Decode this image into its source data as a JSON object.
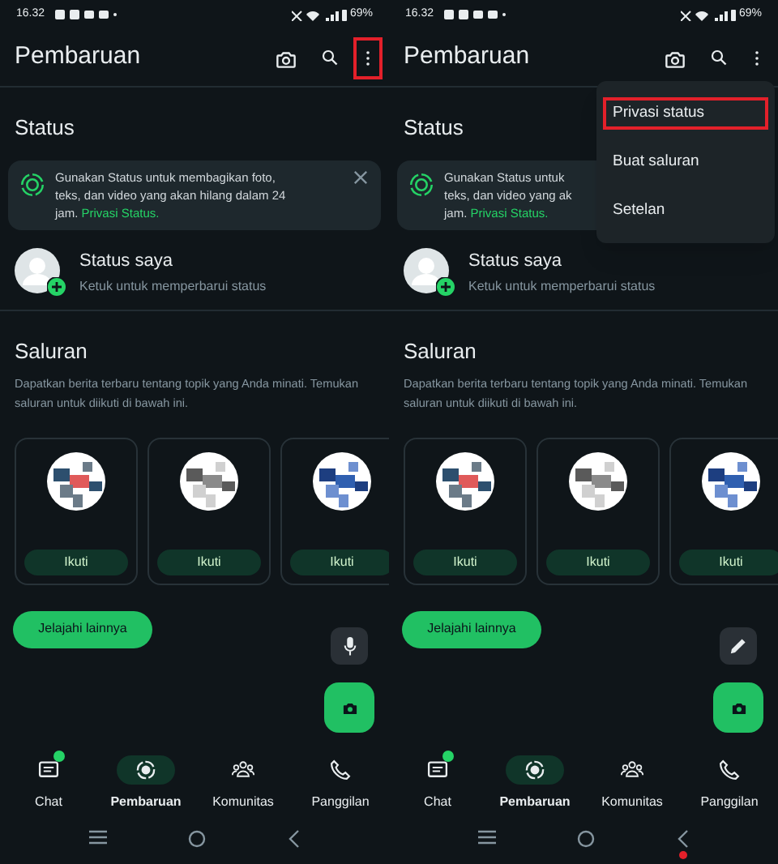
{
  "screens": [
    {
      "status_bar": {
        "time": "16.32",
        "battery": "69%"
      },
      "app_bar": {
        "title": "Pembaruan",
        "more_highlighted": true
      },
      "status": {
        "heading": "Status",
        "tip_lines": [
          "Gunakan Status untuk membagikan foto,",
          "teks, dan video yang akan hilang dalam 24",
          "jam."
        ],
        "tip_link": "Privasi Status.",
        "dismissible": true,
        "my_status": "Status saya",
        "my_status_hint": "Ketuk untuk memperbarui status"
      },
      "channels": {
        "heading": "Saluran",
        "description": "Dapatkan berita terbaru tentang topik yang Anda minati. Temukan saluran untuk diikuti di bawah ini.",
        "cards": [
          {
            "button": "Ikuti"
          },
          {
            "button": "Ikuti"
          },
          {
            "button": "Ikuti"
          }
        ],
        "explore_button": "Jelajahi lainnya"
      },
      "secondary_fab": {
        "kind": "mic"
      },
      "bottom_nav": [
        {
          "label": "Chat",
          "selected": false,
          "dot": true
        },
        {
          "label": "Pembaruan",
          "selected": true,
          "dot": false
        },
        {
          "label": "Komunitas",
          "selected": false,
          "dot": false
        },
        {
          "label": "Panggilan",
          "selected": false,
          "dot": false
        }
      ],
      "system_nav": {
        "back_dot": false
      }
    },
    {
      "status_bar": {
        "time": "16.32",
        "battery": "69%"
      },
      "app_bar": {
        "title": "Pembaruan",
        "more_highlighted": false
      },
      "menu": [
        {
          "label": "Privasi status",
          "highlighted": true
        },
        {
          "label": "Buat saluran",
          "highlighted": false
        },
        {
          "label": "Setelan",
          "highlighted": false
        }
      ],
      "status": {
        "heading": "Status",
        "tip_lines": [
          "Gunakan Status untuk",
          "teks, dan video yang ak",
          "jam."
        ],
        "tip_link": "Privasi Status.",
        "my_status": "Status saya",
        "my_status_hint": "Ketuk untuk memperbarui status"
      },
      "channels": {
        "heading": "Saluran",
        "description": "Dapatkan berita terbaru tentang topik yang Anda minati. Temukan saluran untuk diikuti di bawah ini.",
        "cards": [
          {
            "button": "Ikuti"
          },
          {
            "button": "Ikuti"
          },
          {
            "button": "Ikuti"
          }
        ],
        "explore_button": "Jelajahi lainnya"
      },
      "secondary_fab": {
        "kind": "pencil"
      },
      "bottom_nav": [
        {
          "label": "Chat",
          "selected": false,
          "dot": true
        },
        {
          "label": "Pembaruan",
          "selected": true,
          "dot": false
        },
        {
          "label": "Komunitas",
          "selected": false,
          "dot": false
        },
        {
          "label": "Panggilan",
          "selected": false,
          "dot": false
        }
      ],
      "system_nav": {
        "back_dot": true
      }
    }
  ]
}
